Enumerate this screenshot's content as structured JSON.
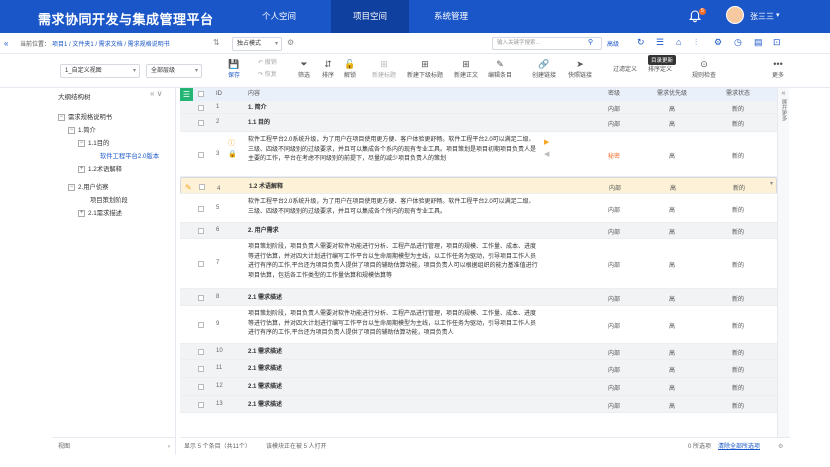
{
  "header": {
    "brand": "需求协同开发与集成管理平台",
    "nav": [
      "个人空间",
      "项目空间",
      "系统管理"
    ],
    "active_nav": 1,
    "notification_count": "5",
    "user_name": "张三三"
  },
  "crumb": {
    "prefix": "当前位置：",
    "path": "项目1 / 文件夹1 / 需求文档 / 需求规格说明书",
    "mode_select": "独占模式",
    "search_placeholder": "输入关键字搜索...",
    "advanced": "高级"
  },
  "toolbar": {
    "view_select": "1_自定义视图",
    "level_select": "全部层级",
    "tools": [
      "保存",
      "撤销",
      "恢复",
      "筛选",
      "排序",
      "解锁",
      "新建标题",
      "新建下级标题",
      "新建正文",
      "编辑条目",
      "创建链接",
      "快照链接",
      "过滤定义",
      "排序定义",
      "规则检查"
    ],
    "tooltip": "目录更新",
    "more": "更多"
  },
  "sidebar": {
    "title": "大纲结构树",
    "footer": "视图",
    "items": [
      "需求规格说明书",
      "1.简介",
      "1.1目的",
      "软件工程平台2.0版本",
      "1.2术语解释",
      "2.用户侦察",
      "项目策划阶段",
      "2.1需求描述"
    ]
  },
  "table": {
    "columns": [
      "ID",
      "内容",
      "密级",
      "需求优先级",
      "需求状态"
    ],
    "rows": [
      {
        "id": "1",
        "content": "1. 简介",
        "level": "内部",
        "priority": "高",
        "status": "新的",
        "bold": true
      },
      {
        "id": "2",
        "content": "1.1 目的",
        "level": "内部",
        "priority": "高",
        "status": "新的",
        "bold": true
      },
      {
        "id": "3",
        "content": "软件工程平台2.0系统升级，为了用户在项目使用更方便、客户体验更舒畅。软件工程平台2.0可以满足二级、三级、四级不同级别的过级要求，并且可以集成各个系内的现有专业工具。项目策划是项目初期项目负责人是主要的工作，平台在考虑不同级别的前提下，尽量的减少项目负责人的策划",
        "level": "秘密",
        "priority": "高",
        "status": "新的",
        "bold": false
      },
      {
        "id": "4",
        "content": "1.2 术语解释",
        "level": "内部",
        "priority": "高",
        "status": "新的",
        "bold": true
      },
      {
        "id": "5",
        "content": "软件工程平台2.0系统升级，为了用户在项目使用更方便、客户体验更舒畅。软件工程平台2.0可以满足二级、三级、四级不同级别的过级要求，并且可以集成各个所内的现有专业工具。",
        "level": "内部",
        "priority": "高",
        "status": "新的",
        "bold": false
      },
      {
        "id": "6",
        "content": "2. 用户需求",
        "level": "内部",
        "priority": "高",
        "status": "新的",
        "bold": true
      },
      {
        "id": "7",
        "content": "项目策划阶段，项目负责人需要对软件功能进行分析、工程产品进行管理，项目的规模、工作量、成本、进度等进行估算，并对四大计划进行编写工作平台以生命周期模型为主线，以工作任务为驱动，引导项目工作人员进行有序的工作,平台还为项目负责人提供了项目的辅助估算功能，项目负责人可以根据组织的能力基准值进行项目估算，包括各工作类型的工作量估算和规模估算等",
        "level": "内部",
        "priority": "高",
        "status": "新的",
        "bold": false
      },
      {
        "id": "8",
        "content": "2.1 需求描述",
        "level": "内部",
        "priority": "高",
        "status": "新的",
        "bold": true
      },
      {
        "id": "9",
        "content": "项目策划阶段，项目负责人需要对软件功能进行分析、工程产品进行管理，项目的规模、工作量、成本、进度等进行估算，并对四大计划进行编写工作平台以生命周期模型为主线，以工作任务为驱动，引导项目工作人员进行有序的工作,平台还为项目负责人提供了项目的辅助估算功能，项目负责人",
        "level": "内部",
        "priority": "高",
        "status": "新的",
        "bold": false
      },
      {
        "id": "10",
        "content": "2.1 需求描述",
        "level": "内部",
        "priority": "高",
        "status": "新的",
        "bold": true
      },
      {
        "id": "11",
        "content": "2.1 需求描述",
        "level": "内部",
        "priority": "高",
        "status": "新的",
        "bold": true
      },
      {
        "id": "12",
        "content": "2.1 需求描述",
        "level": "内部",
        "priority": "高",
        "status": "新的",
        "bold": true
      },
      {
        "id": "13",
        "content": "2.1 需求描述",
        "level": "内部",
        "priority": "高",
        "status": "新的",
        "bold": true
      }
    ]
  },
  "right_panel": "展开更多",
  "footer": {
    "left": "显示 5 个条目（共11个）",
    "right_info": "该模块正在被 5 人打开",
    "selected": "0 所选项",
    "clear": "清除全部所选项"
  },
  "colors": {
    "brand": "#1a56c8",
    "secret": "#f56c2a"
  }
}
